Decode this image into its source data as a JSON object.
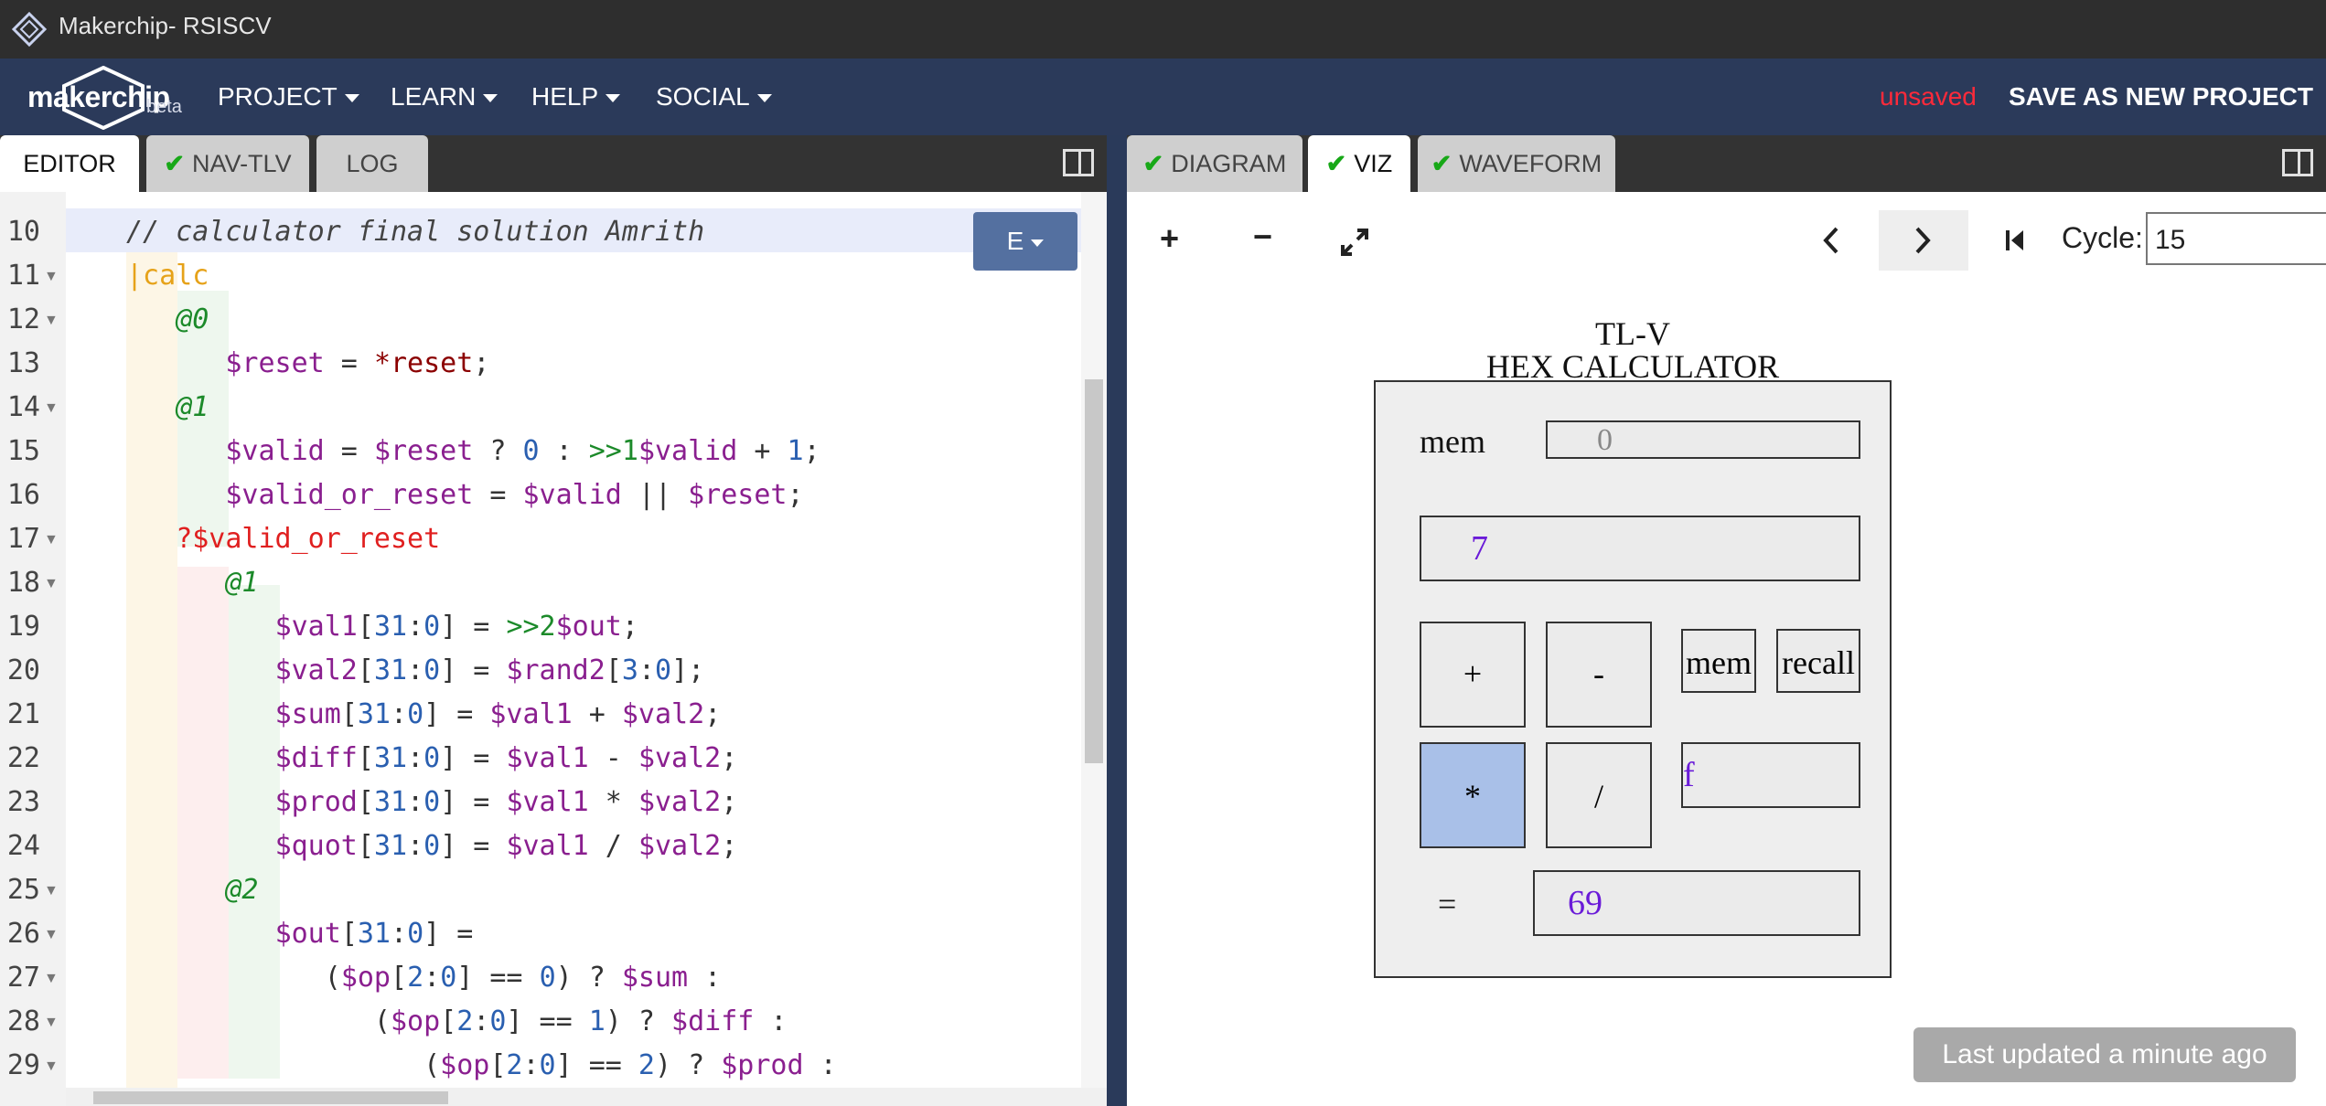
{
  "window": {
    "title": "Makerchip- RSISCV"
  },
  "navbar": {
    "brand": "makerchip",
    "beta": "beta",
    "menus": [
      "PROJECT",
      "LEARN",
      "HELP",
      "SOCIAL"
    ],
    "unsaved": "unsaved",
    "save_as_new": "SAVE AS NEW PROJECT"
  },
  "left_tabs": [
    {
      "label": "EDITOR"
    },
    {
      "label": "NAV-TLV"
    },
    {
      "label": "LOG"
    }
  ],
  "right_tabs": [
    {
      "label": "DIAGRAM"
    },
    {
      "label": "VIZ"
    },
    {
      "label": "WAVEFORM"
    }
  ],
  "editor": {
    "mode_button": "E",
    "line_numbers": [
      "10",
      "11",
      "12",
      "13",
      "14",
      "15",
      "16",
      "17",
      "18",
      "19",
      "20",
      "21",
      "22",
      "23",
      "24",
      "25",
      "26",
      "27",
      "28",
      "29"
    ]
  },
  "viz": {
    "cycle_label": "Cycle:",
    "cycle_value": "15",
    "title_line1": "TL-V",
    "title_line2": "HEX CALCULATOR",
    "mem_label": "mem",
    "mem_value": "0",
    "display_value": "7",
    "btn_plus": "+",
    "btn_minus": "-",
    "btn_mem": "mem",
    "btn_recall": "recall",
    "btn_mul": "*",
    "btn_div": "/",
    "op_value": "f",
    "equals": "=",
    "result_value": "69",
    "highlight_color": "#a9c0e8",
    "value_color": "#6a1bd8"
  },
  "toast": "Last updated a minute ago",
  "colors": {
    "navbar": "#2b3a5a",
    "unsaved": "#ff2a3a",
    "check": "#18a818"
  }
}
